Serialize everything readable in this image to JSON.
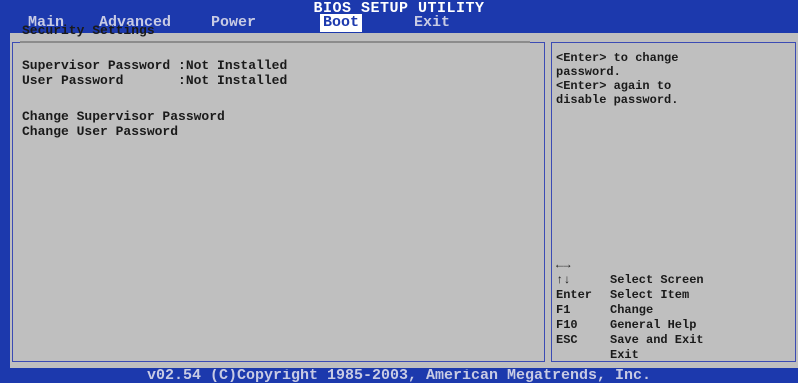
{
  "header": {
    "title": "BIOS SETUP UTILITY",
    "menu": [
      {
        "label": "Main"
      },
      {
        "label": "Advanced"
      },
      {
        "label": "Power"
      },
      {
        "label": "Boot"
      },
      {
        "label": "Exit"
      }
    ],
    "active_menu": "Boot"
  },
  "left_panel": {
    "section_title": "Security Settings",
    "fields": [
      {
        "label": "Supervisor Password :",
        "value": "Not Installed"
      },
      {
        "label": "User Password       :",
        "value": "Not Installed"
      }
    ],
    "actions": [
      {
        "label": "Change Supervisor Password"
      },
      {
        "label": "Change User Password"
      }
    ]
  },
  "right_panel": {
    "help_lines": [
      "<Enter> to change",
      "password.",
      "<Enter> again to",
      "disable password."
    ],
    "keys": [
      {
        "key": "←→",
        "desc": "Select Screen"
      },
      {
        "key": "↑↓",
        "desc": "Select Item"
      },
      {
        "key": "Enter",
        "desc": "Change"
      },
      {
        "key": "F1",
        "desc": "General Help"
      },
      {
        "key": "F10",
        "desc": "Save and Exit"
      },
      {
        "key": "ESC",
        "desc": "Exit"
      }
    ]
  },
  "footer": {
    "text": "v02.54 (C)Copyright 1985-2003, American Megatrends, Inc."
  },
  "colors": {
    "background_blue": "#1c39ad",
    "panel_gray": "#bfbfbf",
    "text_dark": "#1a1a1a",
    "menu_text": "#c8cbe4"
  }
}
